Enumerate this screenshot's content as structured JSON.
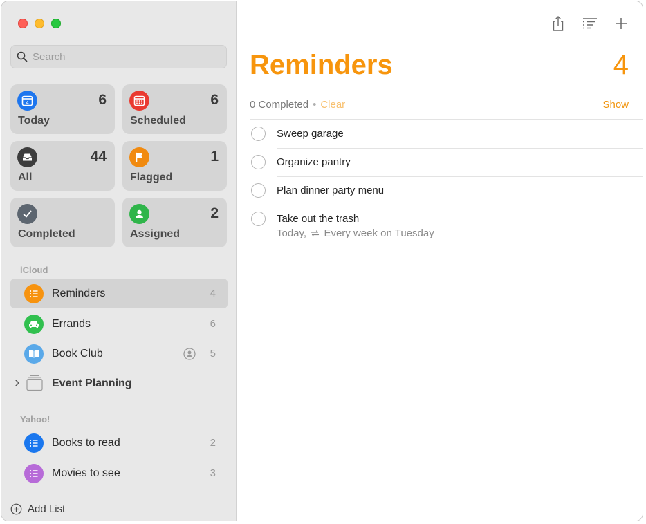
{
  "sidebar": {
    "search": {
      "placeholder": "Search",
      "value": ""
    },
    "smart_lists": [
      {
        "label": "Today",
        "count": "6",
        "color": "#1e76ee",
        "icon": "calendar-today-icon"
      },
      {
        "label": "Scheduled",
        "count": "6",
        "color": "#ea3a30",
        "icon": "calendar-scheduled-icon"
      },
      {
        "label": "All",
        "count": "44",
        "color": "#3d3d3d",
        "icon": "tray-icon"
      },
      {
        "label": "Flagged",
        "count": "1",
        "color": "#f18a0f",
        "icon": "flag-icon"
      },
      {
        "label": "Completed",
        "count": "",
        "color": "#5d6670",
        "icon": "checkmark-icon"
      },
      {
        "label": "Assigned",
        "count": "2",
        "color": "#2fb54a",
        "icon": "person-icon"
      }
    ],
    "sections": [
      {
        "name": "iCloud",
        "lists": [
          {
            "name": "Reminders",
            "count": "4",
            "color": "#f7930f",
            "icon": "list-bullet-icon",
            "selected": true
          },
          {
            "name": "Errands",
            "count": "6",
            "color": "#31c04f",
            "icon": "car-icon"
          },
          {
            "name": "Book Club",
            "count": "5",
            "color": "#5aa9e9",
            "icon": "book-icon",
            "shared": true
          }
        ],
        "group": {
          "name": "Event Planning"
        }
      },
      {
        "name": "Yahoo!",
        "lists": [
          {
            "name": "Books to read",
            "count": "2",
            "color": "#1a77ee",
            "icon": "list-bullet-icon"
          },
          {
            "name": "Movies to see",
            "count": "3",
            "color": "#b76bd8",
            "icon": "list-bullet-icon"
          }
        ]
      }
    ],
    "add_list_label": "Add List"
  },
  "main": {
    "title": "Reminders",
    "count": "4",
    "accent": "#f7950d",
    "completed_text": "0 Completed",
    "clear_label": "Clear",
    "show_label": "Show",
    "tasks": [
      {
        "title": "Sweep garage"
      },
      {
        "title": "Organize pantry"
      },
      {
        "title": "Plan dinner party menu"
      },
      {
        "title": "Take out the trash",
        "subtitle_prefix": "Today,",
        "subtitle_repeat": "Every week on Tuesday"
      }
    ]
  }
}
